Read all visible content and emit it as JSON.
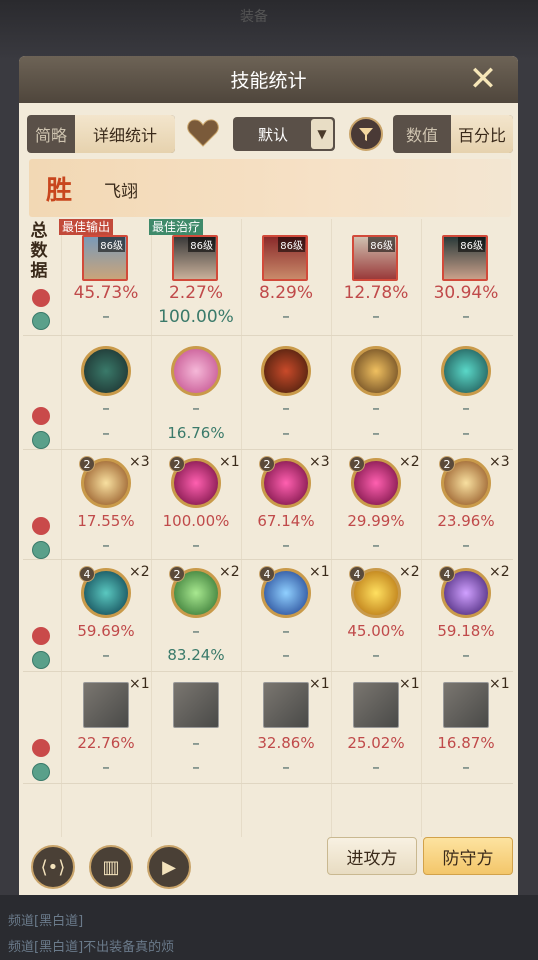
{
  "background": {
    "top_text": "装备",
    "chat": [
      {
        "prefix": "频道",
        "text": "[黑白道]"
      },
      {
        "prefix": "频道",
        "text": "[黑白道]不出装备真的烦"
      }
    ]
  },
  "dialog": {
    "title": "技能统计",
    "close_icon": "close-x-icon"
  },
  "toolbar": {
    "view_tabs": [
      "简略",
      "详细统计"
    ],
    "active_view": "详细统计",
    "sort_value": "默认",
    "value_tabs": [
      "数值",
      "百分比"
    ],
    "active_value": "百分比"
  },
  "team": {
    "result_glyph": "胜",
    "name": "飞翊"
  },
  "summary": {
    "label": "总数据",
    "heroes": [
      {
        "level": "86级",
        "tag": "最佳输出",
        "damage": "45.73%",
        "heal": "–"
      },
      {
        "level": "86级",
        "tag": "最佳治疗",
        "damage": "2.27%",
        "heal": "100.00%"
      },
      {
        "level": "86级",
        "tag": "",
        "damage": "8.29%",
        "heal": "–"
      },
      {
        "level": "86级",
        "tag": "",
        "damage": "12.78%",
        "heal": "–"
      },
      {
        "level": "86级",
        "tag": "",
        "damage": "30.94%",
        "heal": "–"
      }
    ]
  },
  "skill_rows": [
    {
      "cells": [
        {
          "icon": "shadow-warrior-skill-icon",
          "badge": "",
          "mult": "",
          "damage": "–",
          "heal": "–"
        },
        {
          "icon": "lotus-skill-icon",
          "badge": "",
          "mult": "",
          "damage": "–",
          "heal": "16.76%"
        },
        {
          "icon": "red-cloak-skill-icon",
          "badge": "",
          "mult": "",
          "damage": "–",
          "heal": "–"
        },
        {
          "icon": "golden-warrior-skill-icon",
          "badge": "",
          "mult": "",
          "damage": "–",
          "heal": "–"
        },
        {
          "icon": "jade-totem-skill-icon",
          "badge": "",
          "mult": "",
          "damage": "–",
          "heal": "–"
        }
      ]
    },
    {
      "cells": [
        {
          "icon": "golden-slash-skill-icon",
          "badge": "2",
          "mult": "×3",
          "damage": "17.55%",
          "heal": "–"
        },
        {
          "icon": "magenta-claw-skill-icon",
          "badge": "2",
          "mult": "×1",
          "damage": "100.00%",
          "heal": "–"
        },
        {
          "icon": "magenta-claw-skill-icon",
          "badge": "2",
          "mult": "×3",
          "damage": "67.14%",
          "heal": "–"
        },
        {
          "icon": "magenta-claw-skill-icon",
          "badge": "2",
          "mult": "×2",
          "damage": "29.99%",
          "heal": "–"
        },
        {
          "icon": "golden-slash-skill-icon",
          "badge": "2",
          "mult": "×3",
          "damage": "23.96%",
          "heal": "–"
        }
      ]
    },
    {
      "cells": [
        {
          "icon": "teal-vortex-skill-icon",
          "badge": "4",
          "mult": "×2",
          "damage": "59.69%",
          "heal": "–"
        },
        {
          "icon": "green-drop-skill-icon",
          "badge": "2",
          "mult": "×2",
          "damage": "–",
          "heal": "83.24%"
        },
        {
          "icon": "blue-crystal-skill-icon",
          "badge": "4",
          "mult": "×1",
          "damage": "–",
          "heal": "–"
        },
        {
          "icon": "gold-rune-skill-icon",
          "badge": "4",
          "mult": "×2",
          "damage": "45.00%",
          "heal": "–"
        },
        {
          "icon": "purple-lightning-skill-icon",
          "badge": "4",
          "mult": "×2",
          "damage": "59.18%",
          "heal": "–"
        }
      ]
    },
    {
      "cells": [
        {
          "icon": "jade-hammer-item-icon",
          "badge": "",
          "mult": "×1",
          "damage": "22.76%",
          "heal": "–"
        },
        {
          "icon": "jade-vase-item-icon",
          "badge": "",
          "mult": "",
          "damage": "–",
          "heal": "–"
        },
        {
          "icon": "blade-disc-item-icon",
          "badge": "",
          "mult": "×1",
          "damage": "32.86%",
          "heal": "–"
        },
        {
          "icon": "jade-hammer-item-icon",
          "badge": "",
          "mult": "×1",
          "damage": "25.02%",
          "heal": "–"
        },
        {
          "icon": "jade-hammer-item-icon",
          "badge": "",
          "mult": "×1",
          "damage": "16.87%",
          "heal": "–"
        }
      ]
    }
  ],
  "bottom": {
    "share_icon": "share-icon",
    "scroll_icon": "scroll-icon",
    "replay_icon": "video-replay-icon",
    "attack_label": "进攻方",
    "defense_label": "防守方",
    "active_side": "防守方"
  },
  "colors": {
    "damage": "#c04a4a",
    "heal": "#3a7a6a",
    "accent": "#c9a46a",
    "active_tab": "#e6d2ae"
  }
}
